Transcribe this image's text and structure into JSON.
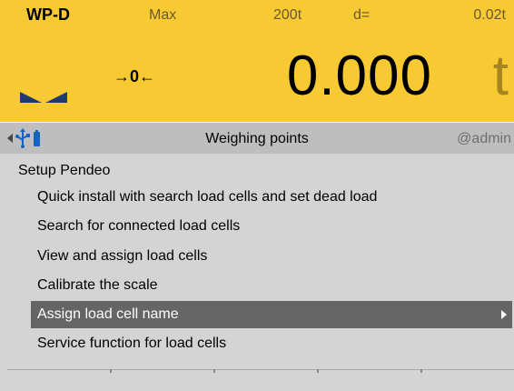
{
  "weight_panel": {
    "wp_label": "WP-D",
    "max_label": "Max",
    "max_value": "200t",
    "d_label": "d=",
    "d_value": "0.02t",
    "zero_indicator": "→0←",
    "weight_value": "0.000",
    "unit": "t",
    "stable_icon": "stability-triangles-icon"
  },
  "title_bar": {
    "left_icons": [
      "left-arrow-icon",
      "usb-icon",
      "battery-icon"
    ],
    "title": "Weighing points",
    "user": "@admin"
  },
  "menu": {
    "heading": "Setup Pendeo",
    "items": [
      {
        "label": "Quick install with search load cells and set dead load",
        "selected": false
      },
      {
        "label": "Search for connected load cells",
        "selected": false
      },
      {
        "label": "View and assign load cells",
        "selected": false
      },
      {
        "label": "Calibrate the scale",
        "selected": false
      },
      {
        "label": "Assign load cell name",
        "selected": true
      },
      {
        "label": "Service function for load cells",
        "selected": false
      }
    ]
  },
  "softkeys": [
    "",
    "",
    "",
    "",
    "",
    ""
  ],
  "colors": {
    "panel": "#f7c932",
    "title_bar": "#bebebe",
    "background": "#d4d4d4",
    "selected": "#656565"
  }
}
